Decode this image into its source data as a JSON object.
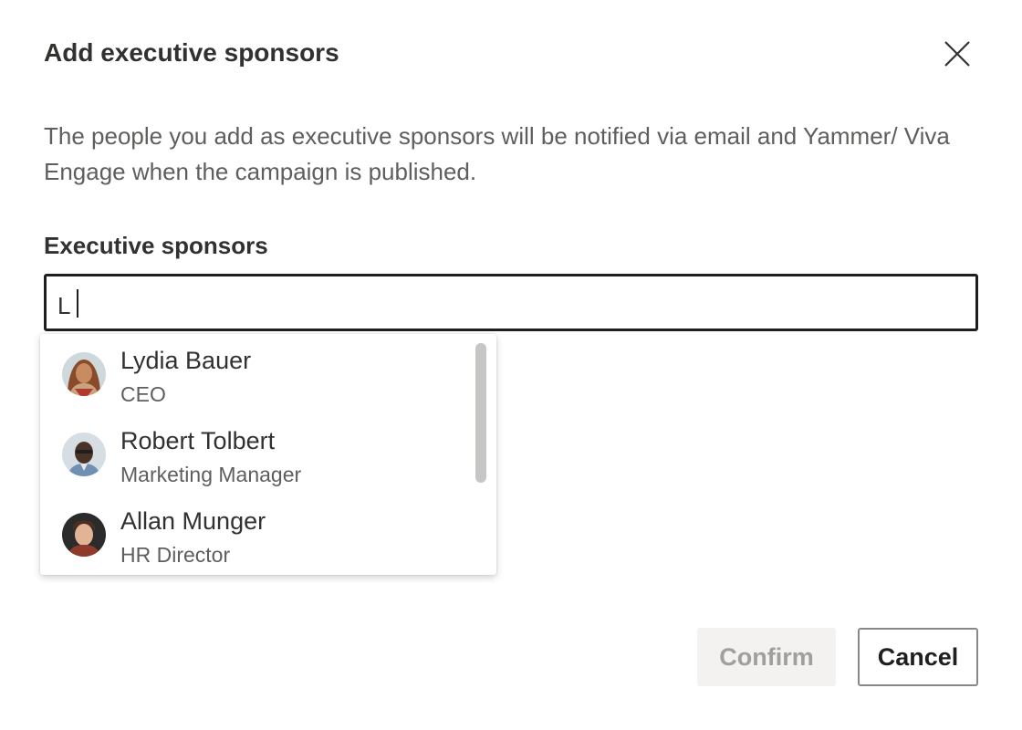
{
  "dialog": {
    "title": "Add executive sponsors",
    "close_icon": "close-icon",
    "description": "The people you add as executive sponsors will be notified via email and Yammer/ Viva Engage when the campaign is published."
  },
  "field": {
    "label": "Executive sponsors",
    "value": "L"
  },
  "suggestions": [
    {
      "name": "Lydia Bauer",
      "role": "CEO",
      "avatar_icon": "person-avatar-icon"
    },
    {
      "name": "Robert Tolbert",
      "role": "Marketing Manager",
      "avatar_icon": "person-avatar-icon"
    },
    {
      "name": "Allan Munger",
      "role": "HR Director",
      "avatar_icon": "person-avatar-icon"
    }
  ],
  "buttons": {
    "confirm": "Confirm",
    "cancel": "Cancel"
  },
  "colors": {
    "text_primary": "#323130",
    "text_secondary": "#605e5c",
    "input_border": "#201f1e",
    "confirm_disabled_bg": "#f3f2f1",
    "confirm_disabled_text": "#a19f9d"
  }
}
